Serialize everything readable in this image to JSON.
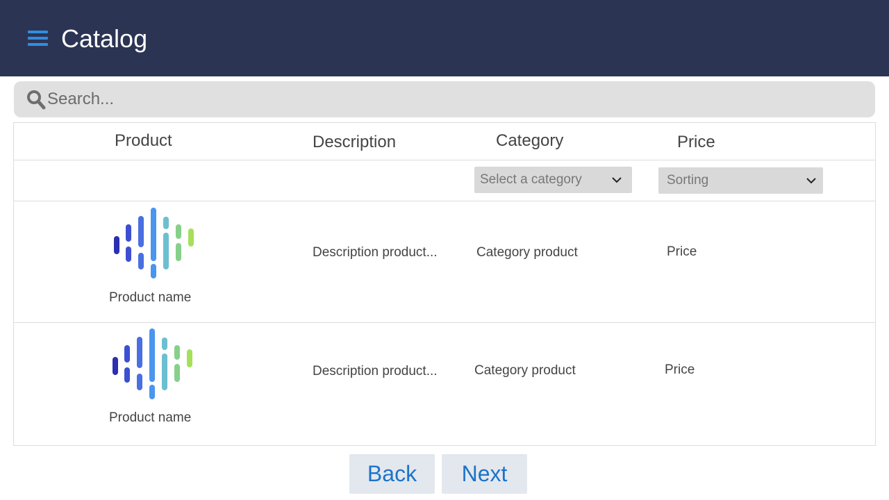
{
  "header": {
    "title": "Catalog",
    "menu_icon": "hamburger-menu-icon",
    "background": "#2c3454",
    "accent": "#2f8ee0"
  },
  "search": {
    "placeholder": "Search...",
    "value": "",
    "icon": "search-icon"
  },
  "table": {
    "columns": [
      "Product",
      "Description",
      "Category",
      "Price"
    ],
    "filters": {
      "category": {
        "selected": "Select a category"
      },
      "price": {
        "selected": "Sorting"
      }
    },
    "rows": [
      {
        "product_name": "Product name",
        "description": "Description product...",
        "category": "Category product",
        "price": "Price",
        "logo": "sound-wave-logo"
      },
      {
        "product_name": "Product name",
        "description": "Description product...",
        "category": "Category product",
        "price": "Price",
        "logo": "sound-wave-logo"
      }
    ]
  },
  "pagination": {
    "back_label": "Back",
    "next_label": "Next",
    "link_color": "#1d73c9"
  }
}
